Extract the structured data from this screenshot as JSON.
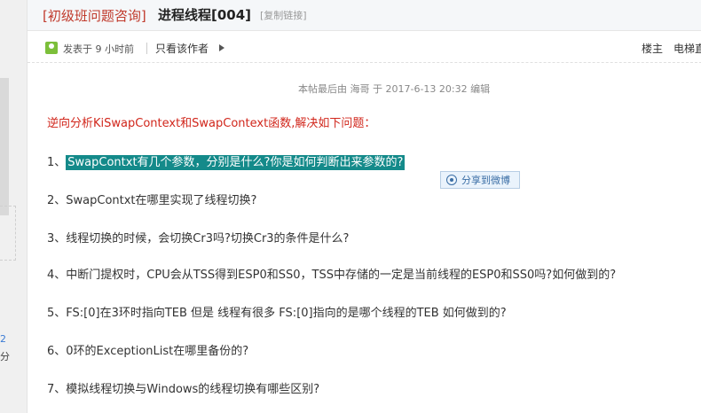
{
  "left": {
    "number": "2",
    "unit": "分"
  },
  "header": {
    "category": "[初级班问题咨询]",
    "title": "进程线程[004]",
    "copy_link": "[复制链接]"
  },
  "meta": {
    "posted": "发表于 9 小时前",
    "author_only": "只看该作者",
    "floor_owner": "楼主",
    "elevator": "电梯直"
  },
  "post": {
    "edit_note": "本帖最后由 海哥 于 2017-6-13 20:32 编辑",
    "instruction": "逆向分析KiSwapContext和SwapContext函数,解决如下问题：",
    "q1_prefix": "1、",
    "q1_highlight": "SwapContxt有几个参数，分别是什么?你是如何判断出来参数的?",
    "q2": "2、SwapContxt在哪里实现了线程切换?",
    "q3": "3、线程切换的时候，会切换Cr3吗?切换Cr3的条件是什么?",
    "q4": "4、中断门提权时，CPU会从TSS得到ESP0和SS0，TSS中存储的一定是当前线程的ESP0和SS0吗?如何做到的?",
    "q5": "5、FS:[0]在3环时指向TEB  但是 线程有很多 FS:[0]指向的是哪个线程的TEB 如何做到的?",
    "q6": "6、0环的ExceptionList在哪里备份的?",
    "q7": "7、模拟线程切换与Windows的线程切换有哪些区别?"
  },
  "share": {
    "label": "分享到微博",
    "icon": "weibo-icon"
  }
}
